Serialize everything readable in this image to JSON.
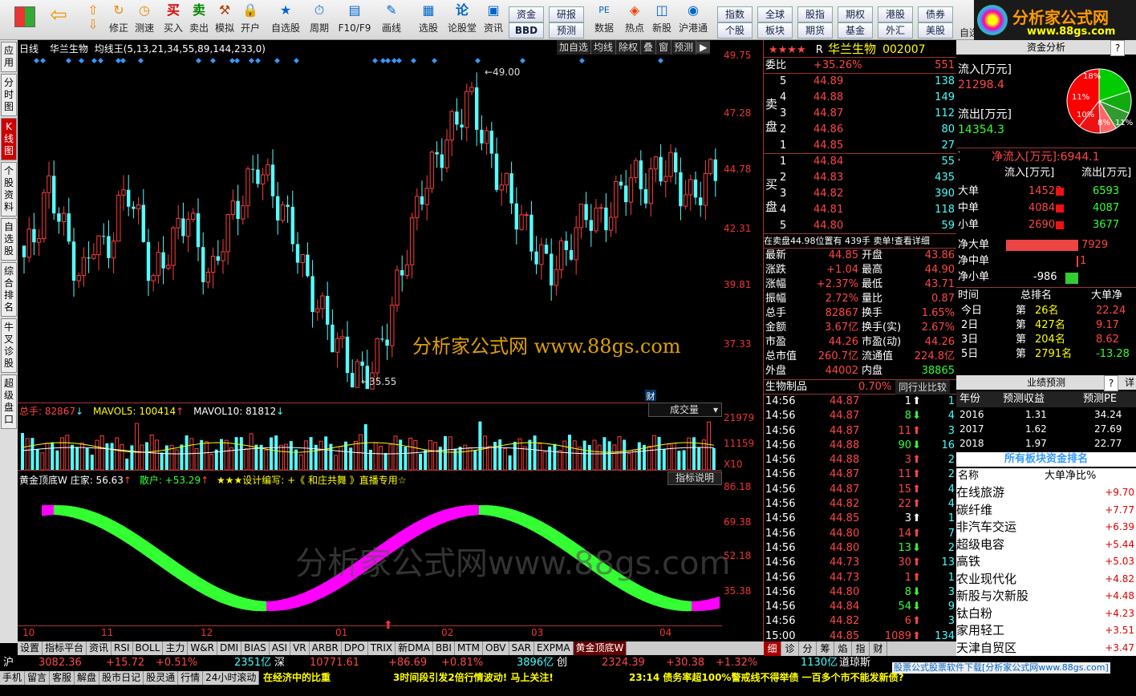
{
  "toolbar": {
    "items": [
      "修正",
      "测速",
      "买入",
      "卖出",
      "模拟",
      "开户",
      "自选股",
      "周期",
      "F10/F9",
      "画线",
      "选股",
      "论股堂",
      "资讯",
      "数据",
      "热点",
      "新股",
      "沪港通"
    ],
    "blue1": [
      "资金",
      "研报",
      "BBD",
      "预测"
    ],
    "blue2": [
      "指数",
      "全球",
      "股指",
      "期权",
      "港股",
      "债券",
      "个股",
      "板块",
      "期货",
      "基金",
      "外汇",
      "美股"
    ],
    "auto": "自选"
  },
  "logo": {
    "text": "分析家公式网",
    "url": "www.88gs.com"
  },
  "lefttabs": [
    "应用",
    "分时图",
    "K线图",
    "个股资料",
    "自选股",
    "综合排名",
    "牛叉诊股",
    "超级盘口"
  ],
  "chart": {
    "period": "日线",
    "stock": "华兰生物",
    "indicator": "均线王(5,13,21,34,55,89,144,233,0)",
    "buttons": [
      "加自选",
      "均线",
      "除权",
      "叠",
      "窗",
      "预测"
    ],
    "yaxis": [
      "49.75",
      "47.28",
      "44.78",
      "42.31",
      "39.81",
      "37.33"
    ],
    "high": "49.00",
    "low": "35.55",
    "watermark": "分析家公式网 www.88gs.com"
  },
  "volume": {
    "label": "总手: 82867",
    "mavol5": "MAVOL5: 100414",
    "mavol10": "MAVOL10: 81812",
    "select": "成交量",
    "yaxis": [
      "21979",
      "11159",
      "X10"
    ],
    "cai": "财"
  },
  "ind": {
    "title": "黄金顶底W",
    "zhuang": "庄家: 56.63",
    "san": "散户: +53.29",
    "desc": "★★★设计编写: +《 和庄共舞 》直播专用☆",
    "help": "指标说明",
    "yaxis": [
      "86.18",
      "69.38",
      "52.18",
      "35.38"
    ],
    "watermark": "分析家公式网www.88gs.com"
  },
  "xaxis": [
    "10",
    "11",
    "12",
    "01",
    "02",
    "03",
    "04"
  ],
  "tabs": [
    "设置",
    "指标平台",
    "资讯",
    "RSI",
    "BOLL",
    "主力",
    "W&R",
    "DMI",
    "BIAS",
    "ASI",
    "VR",
    "ARBR",
    "DPO",
    "TRIX",
    "新DMA",
    "BBI",
    "MTM",
    "OBV",
    "SAR",
    "EXPMA",
    "黄金顶底W"
  ],
  "quote": {
    "stars": "★★★★",
    "r": "R",
    "name": "华兰生物",
    "code": "002007",
    "weibi": "委比",
    "weibi_v": "+35.26%",
    "weibi_n": "551",
    "sell_label": "卖盘",
    "buy_label": "买盘",
    "sell": [
      [
        "5",
        "44.89",
        "138"
      ],
      [
        "4",
        "44.88",
        "149"
      ],
      [
        "3",
        "44.87",
        "112"
      ],
      [
        "2",
        "44.86",
        "80"
      ],
      [
        "1",
        "44.85",
        "27"
      ]
    ],
    "buy": [
      [
        "1",
        "44.84",
        "55"
      ],
      [
        "2",
        "44.83",
        "435"
      ],
      [
        "3",
        "44.82",
        "390"
      ],
      [
        "4",
        "44.81",
        "118"
      ],
      [
        "5",
        "44.80",
        "59"
      ]
    ],
    "note": "在卖盘44.98位置有 439手 卖单!查看详细",
    "stats": [
      [
        "最新",
        "44.85",
        "开盘",
        "43.86"
      ],
      [
        "涨跌",
        "+1.04",
        "最高",
        "44.90"
      ],
      [
        "涨幅",
        "+2.37%",
        "最低",
        "43.71"
      ],
      [
        "振幅",
        "2.72%",
        "量比",
        "0.87"
      ],
      [
        "总手",
        "82867",
        "换手",
        "1.65%"
      ],
      [
        "金额",
        "3.67亿",
        "换手(实)",
        "2.67%"
      ],
      [
        "市盈",
        "44.26",
        "市盈(动)",
        "44.26"
      ],
      [
        "总市值",
        "260.7亿",
        "流通值",
        "224.8亿"
      ],
      [
        "外盘",
        "44002",
        "内盘",
        "38865"
      ]
    ],
    "industry": "生物制品",
    "industry_v": "0.70%",
    "compare": "同行业比较",
    "ticks": [
      [
        "14:56",
        "44.87",
        "1",
        "1"
      ],
      [
        "14:56",
        "44.87",
        "8",
        "4"
      ],
      [
        "14:56",
        "44.87",
        "11",
        "3"
      ],
      [
        "14:56",
        "44.88",
        "90",
        "16"
      ],
      [
        "14:56",
        "44.88",
        "3",
        "2"
      ],
      [
        "14:56",
        "44.87",
        "11",
        "2"
      ],
      [
        "14:56",
        "44.87",
        "15",
        "4"
      ],
      [
        "14:56",
        "44.82",
        "22",
        "4"
      ],
      [
        "14:56",
        "44.85",
        "3",
        "1"
      ],
      [
        "14:56",
        "44.80",
        "14",
        "7"
      ],
      [
        "14:56",
        "44.80",
        "13",
        "2"
      ],
      [
        "14:56",
        "44.73",
        "30",
        "13"
      ],
      [
        "14:56",
        "44.73",
        "1",
        "1"
      ],
      [
        "14:56",
        "44.80",
        "8",
        "3"
      ],
      [
        "14:56",
        "44.84",
        "54",
        "9"
      ],
      [
        "14:56",
        "44.82",
        "6",
        "3"
      ],
      [
        "15:00",
        "44.85",
        "1089",
        "134"
      ]
    ],
    "bottabs": [
      "细",
      "诊",
      "分",
      "筹",
      "焰",
      "指",
      "财"
    ]
  },
  "right": {
    "title": "资金分析",
    "pie": [
      "18%",
      "11%",
      "10%",
      "8%",
      "11%"
    ],
    "inflow": "流入[万元]",
    "inflow_v": "21298.4",
    "outflow": "流出[万元]",
    "outflow_v": "14354.3",
    "net": "净流入[万元]:6944.1",
    "h_in": "流入[万元]",
    "h_out": "流出[万元]",
    "rows": [
      [
        "大单",
        "14523",
        "6593"
      ],
      [
        "中单",
        "4084",
        "4087"
      ],
      [
        "小单",
        "2690",
        "3677"
      ]
    ],
    "nets": [
      [
        "净大单",
        "7929"
      ],
      [
        "净中单",
        "1"
      ],
      [
        "净小单",
        "-986"
      ]
    ],
    "rank_h": [
      "时间",
      "总排名",
      "大单净"
    ],
    "ranks": [
      [
        "今日",
        "第",
        "26名",
        "22.24"
      ],
      [
        "2日",
        "第",
        "427名",
        "9.17"
      ],
      [
        "3日",
        "第",
        "204名",
        "8.62"
      ],
      [
        "5日",
        "第",
        "2791名",
        "-13.28"
      ]
    ],
    "perf": "业绩预测",
    "detail": "详",
    "perf_h": [
      "年份",
      "预测収益",
      "预测PE"
    ],
    "perf_rows": [
      [
        "2016",
        "1.31",
        "34.24"
      ],
      [
        "2017",
        "1.62",
        "27.69"
      ],
      [
        "2018",
        "1.97",
        "22.77"
      ]
    ],
    "sector_title": "所有板块资金排名",
    "sec_h": [
      "名称",
      "大单净比%"
    ],
    "sectors": [
      [
        "在线旅游",
        "+9.70"
      ],
      [
        "碳纤维",
        "+7.77"
      ],
      [
        "非汽车交运",
        "+6.39"
      ],
      [
        "超级电容",
        "+5.44"
      ],
      [
        "高铁",
        "+5.03"
      ],
      [
        "农业现代化",
        "+4.82"
      ],
      [
        "新股与次新股",
        "+4.48"
      ],
      [
        "钛白粉",
        "+4.23"
      ],
      [
        "家用轻工",
        "+3.51"
      ],
      [
        "天津自贸区",
        "+3.47"
      ]
    ]
  },
  "status": {
    "sh": "沪",
    "sh_v": "3082.36",
    "sh_c": "+15.72",
    "sh_p": "+0.51%",
    "sh_a": "2351亿",
    "sz": "深",
    "sz_v": "10771.61",
    "sz_c": "+86.69",
    "sz_p": "+0.81%",
    "sz_a": "3896亿",
    "cy": "创",
    "cy_v": "2324.39",
    "cy_c": "+30.38",
    "cy_p": "+1.32%",
    "cy_a": "1130亿",
    "dj": "道琼斯",
    "links": [
      "手机",
      "留言",
      "客服",
      "解盘",
      "股市日记",
      "股灵通",
      "行情",
      "24小时滚动"
    ],
    "news1": "在经济中的比重",
    "news2": "3时间段引发2倍行情波动! 马上关注!",
    "news3": "23:14 债务率超100%警戒线不得举债 一百多个市不能发新债?",
    "ad": "股票公式股票软件下载[分析家公式网www.88gs.com]"
  }
}
